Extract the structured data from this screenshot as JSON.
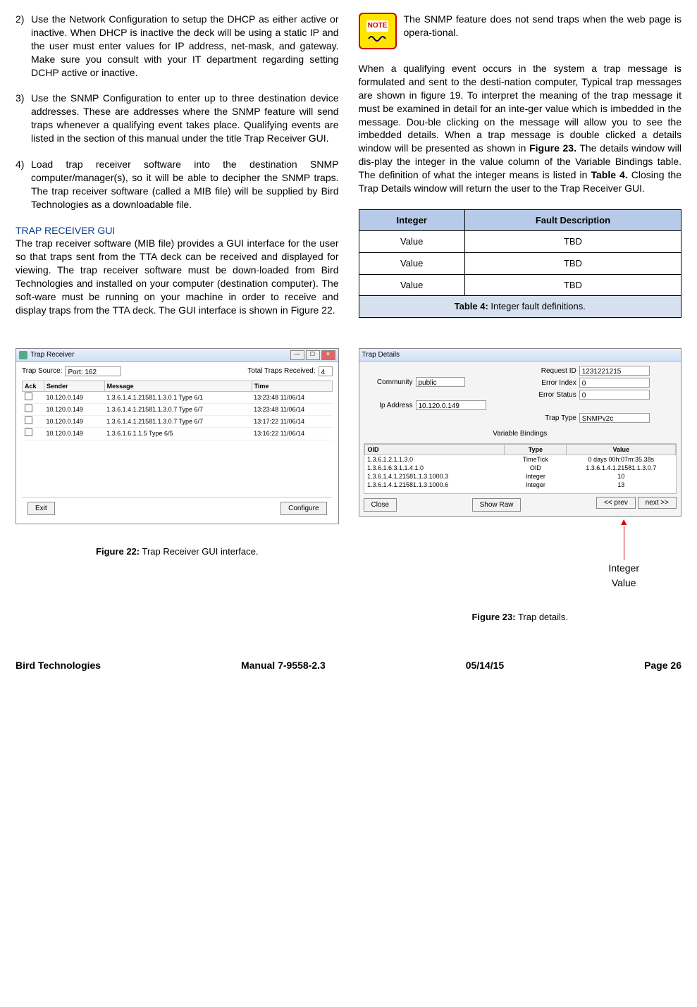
{
  "left": {
    "items": [
      {
        "num": "2)",
        "text": "Use the Network Configuration to setup the DHCP as either active or inactive. When DHCP is inactive the deck will be using a static IP and the user must enter values for IP address, net-mask, and gateway. Make sure you consult with your IT department regarding setting DCHP active or inactive."
      },
      {
        "num": "3)",
        "text": "Use the SNMP Configuration to enter up to three destination device addresses. These are addresses where the SNMP feature will send traps whenever a qualifying event takes place. Qualifying events are listed in the section of this manual under the title Trap Receiver GUI."
      },
      {
        "num": "4)",
        "text": "Load trap receiver software into the destination SNMP computer/manager(s), so it will be able to decipher the SNMP traps. The trap receiver software (called a MIB file) will be supplied by Bird Technologies as a downloadable file."
      }
    ],
    "section_title": "TRAP RECEIVER GUI",
    "para": "The trap receiver software (MIB file) provides a GUI interface for the user so that traps sent from the TTA deck can be received and displayed for viewing. The trap receiver software must be down-loaded from Bird Technologies and installed on your computer (destination computer). The soft-ware must be running on your machine in order to receive and display traps from the TTA deck. The GUI interface is shown in Figure 22."
  },
  "right": {
    "note_label": "NOTE",
    "note_text": "The SNMP feature does not send traps when the web page is opera-tional.",
    "para_a": "When a qualifying event occurs in the system a trap message is formulated and sent to the desti-nation computer, Typical trap messages are shown in figure 19. To interpret the meaning of the trap message it must be examined in detail for an inte-ger value which is imbedded in the message. Dou-ble clicking on the message will allow you to see the imbedded details. When a trap message is double clicked a details window will be presented as shown in ",
    "fig23": "Figure 23.",
    "para_b": " The details window will dis-play the integer in the value column of the Variable Bindings table. The definition of what the integer means is listed in ",
    "tab4": "Table 4.",
    "para_c": " Closing the Trap Details window will return the user to the Trap Receiver GUI.",
    "table": {
      "h1": "Integer",
      "h2": "Fault Description",
      "rows": [
        {
          "a": "Value",
          "b": "TBD"
        },
        {
          "a": "Value",
          "b": "TBD"
        },
        {
          "a": "Value",
          "b": "TBD"
        }
      ],
      "caption_a": "Table 4:",
      "caption_b": " Integer fault definitions."
    }
  },
  "fig22": {
    "title": "Trap Receiver",
    "src_label": "Trap Source:",
    "src_value": "Port: 162",
    "total_label": "Total Traps Received:",
    "total_value": "4",
    "cols": {
      "ack": "Ack",
      "sender": "Sender",
      "msg": "Message",
      "time": "Time"
    },
    "rows": [
      {
        "sender": "10.120.0.149",
        "msg": "1.3.6.1.4.1.21581.1.3.0.1  Type 6/1",
        "time": "13:23:48 11/06/14"
      },
      {
        "sender": "10.120.0.149",
        "msg": "1.3.6.1.4.1.21581.1.3.0.7  Type 6/7",
        "time": "13:23:48 11/06/14"
      },
      {
        "sender": "10.120.0.149",
        "msg": "1.3.6.1.4.1.21581.1.3.0.7  Type 6/7",
        "time": "13:17:22 11/06/14"
      },
      {
        "sender": "10.120.0.149",
        "msg": "1.3.6.1.6.1.1.5  Type 6/5",
        "time": "13:16:22 11/06/14"
      }
    ],
    "exit": "Exit",
    "configure": "Configure",
    "caption_a": "Figure 22:",
    "caption_b": " Trap Receiver GUI interface."
  },
  "fig23": {
    "title": "Trap Details",
    "community_lbl": "Community",
    "community_val": "public",
    "ip_lbl": "Ip Address",
    "ip_val": "10.120.0.149",
    "req_lbl": "Request ID",
    "req_val": "1231221215",
    "erri_lbl": "Error Index",
    "erri_val": "0",
    "errs_lbl": "Error Status",
    "errs_val": "0",
    "trap_lbl": "Trap Type",
    "trap_val": "SNMPv2c",
    "vb_label": "Variable Bindings",
    "vb_cols": {
      "oid": "OID",
      "type": "Type",
      "value": "Value"
    },
    "vb_rows": [
      {
        "oid": "1.3.6.1.2.1.1.3.0",
        "type": "TimeTick",
        "value": "0 days 00h:07m:35.38s"
      },
      {
        "oid": "1.3.6.1.6.3.1.1.4.1.0",
        "type": "OID",
        "value": "1.3.6.1.4.1.21581.1.3.0.7"
      },
      {
        "oid": "1.3.6.1.4.1.21581.1.3.1000.3",
        "type": "Integer",
        "value": "10"
      },
      {
        "oid": "1.3.6.1.4.1.21581.1.3.1000.6",
        "type": "Integer",
        "value": "13"
      }
    ],
    "close": "Close",
    "show_raw": "Show Raw",
    "prev": "<< prev",
    "next": "next >>",
    "arrow_label1": "Integer",
    "arrow_label2": "Value",
    "caption_a": "Figure 23:",
    "caption_b": " Trap details."
  },
  "footer": {
    "a": "Bird Technologies",
    "b": "Manual 7-9558-2.3",
    "c": "05/14/15",
    "d": "Page 26"
  }
}
